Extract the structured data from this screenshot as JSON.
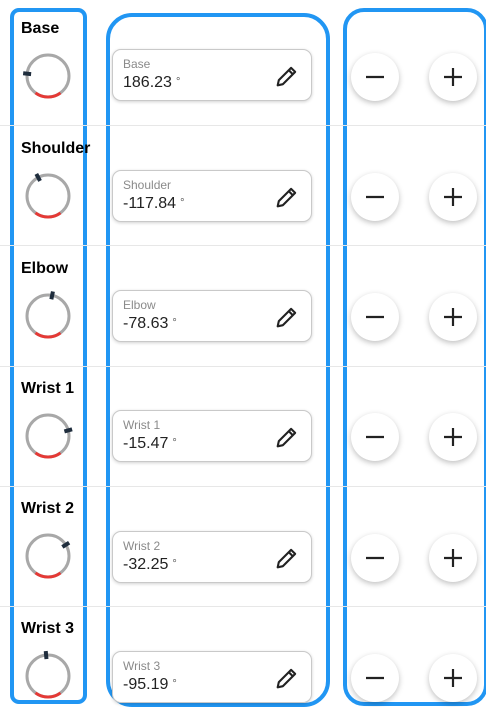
{
  "joints": [
    {
      "name": "Base",
      "field_label": "Base",
      "value": "186.23",
      "unit": "°",
      "angle": 186.23
    },
    {
      "name": "Shoulder",
      "field_label": "Shoulder",
      "value": "-117.84",
      "unit": "°",
      "angle": -117.84
    },
    {
      "name": "Elbow",
      "field_label": "Elbow",
      "value": "-78.63",
      "unit": "°",
      "angle": -78.63
    },
    {
      "name": "Wrist 1",
      "field_label": "Wrist 1",
      "value": "-15.47",
      "unit": "°",
      "angle": -15.47
    },
    {
      "name": "Wrist 2",
      "field_label": "Wrist 2",
      "value": "-32.25",
      "unit": "°",
      "angle": -32.25
    },
    {
      "name": "Wrist 3",
      "field_label": "Wrist 3",
      "value": "-95.19",
      "unit": "°",
      "angle": -95.19
    }
  ],
  "colors": {
    "accent_outline": "#2196f3",
    "dial_ring": "#a8a8a8",
    "dial_limit": "#e53935",
    "dial_indicator": "#1f2d3d"
  },
  "icons": {
    "edit": "pencil-icon",
    "decrease": "minus-icon",
    "increase": "plus-icon"
  }
}
